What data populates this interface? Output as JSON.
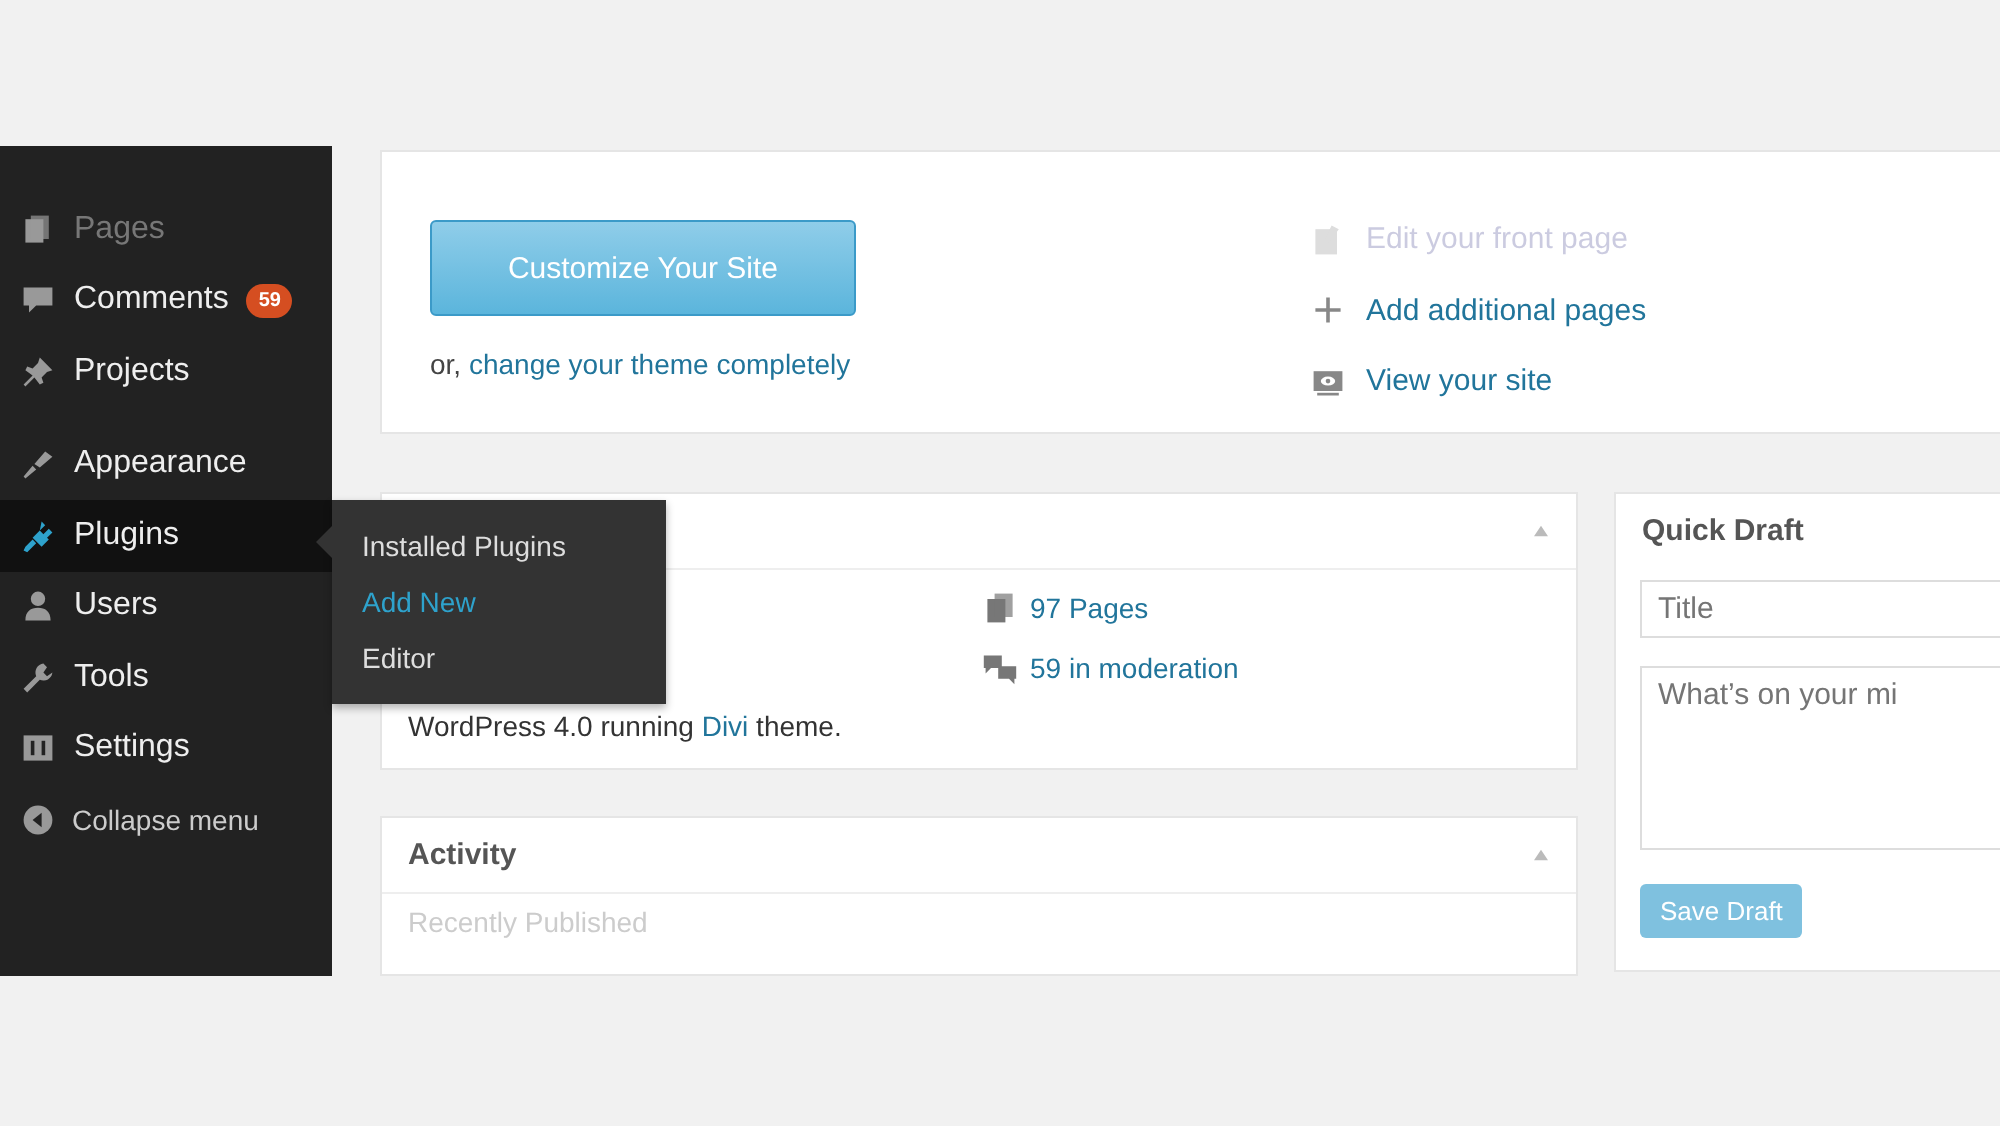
{
  "sidebar": {
    "groups": [
      {
        "items": [
          {
            "label": "Pages",
            "selected": false
          },
          {
            "label": "Comments",
            "badge": "59",
            "selected": false
          },
          {
            "label": "Projects",
            "selected": false
          }
        ]
      },
      {
        "items": [
          {
            "label": "Appearance",
            "selected": false
          },
          {
            "label": "Plugins",
            "selected": true
          },
          {
            "label": "Users",
            "selected": false
          },
          {
            "label": "Tools",
            "selected": false
          },
          {
            "label": "Settings",
            "selected": false
          }
        ]
      }
    ],
    "collapse": "Collapse menu"
  },
  "submenu": {
    "items": [
      {
        "label": "Installed Plugins",
        "selected": false
      },
      {
        "label": "Add New",
        "selected": true
      },
      {
        "label": "Editor",
        "selected": false
      }
    ]
  },
  "welcome": {
    "button": "Customize Your Site",
    "alt_prefix": "or, ",
    "alt_link": "change your theme completely",
    "next_steps": [
      {
        "label": "Edit your front page",
        "faded": true
      },
      {
        "label": "Add additional pages",
        "faded": false
      },
      {
        "label": "View your site",
        "faded": false
      }
    ]
  },
  "at_a_glance": {
    "stats": [
      "97 Pages",
      "59 in moderation"
    ],
    "footer_prefix": "WordPress 4.0 running ",
    "theme_link": "Divi",
    "footer_suffix": " theme."
  },
  "activity": {
    "title": "Activity",
    "subtitle": "Recently Published"
  },
  "quick_draft": {
    "title": "Quick Draft",
    "title_placeholder": "Title",
    "content_placeholder": "What’s on your mi",
    "button": "Save Draft"
  }
}
